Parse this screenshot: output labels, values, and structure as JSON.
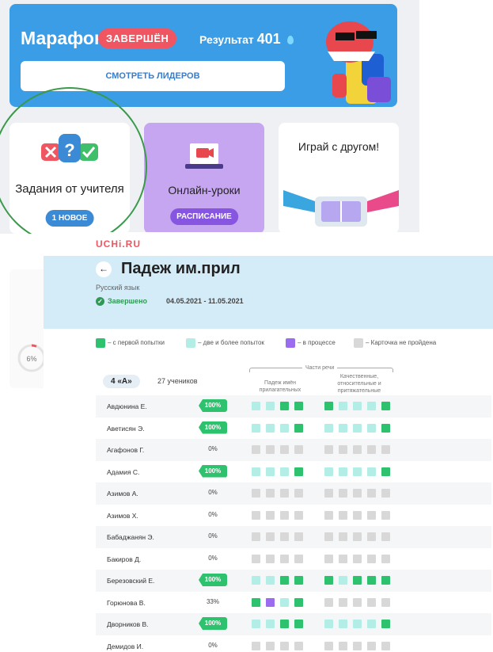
{
  "marathon": {
    "title": "Марафон",
    "status": "ЗАВЕРШЁН",
    "result_label": "Результат",
    "result_value": "401",
    "leaders_button": "СМОТРЕТЬ ЛИДЕРОВ"
  },
  "tiles": {
    "tasks": {
      "label": "Задания от учителя",
      "badge": "1 НОВОЕ"
    },
    "online": {
      "label": "Онлайн-уроки",
      "badge": "РАСПИСАНИЕ"
    },
    "game": {
      "label": "Играй с другом!"
    }
  },
  "side_progress": "6%",
  "report": {
    "logo": "UCHi.RU",
    "title": "Падеж им.прил",
    "subject": "Русский язык",
    "status": "Завершено",
    "dates": "04.05.2021 - 11.05.2021",
    "legend": [
      {
        "label": "– с первой попытки",
        "color": "#2ec26e"
      },
      {
        "label": "– две и более попыток",
        "color": "#b2eee6"
      },
      {
        "label": "– в процессе",
        "color": "#9b6cf0"
      },
      {
        "label": "– Карточка не пройдена",
        "color": "#d8d8d8"
      }
    ],
    "class_name": "4 «А»",
    "student_count": "27 учеников",
    "group_title": "Части речи",
    "subgroups": [
      "Падеж имён прилагательных",
      "Качественные, относительные и притяжательные прилагательные"
    ],
    "status_colors": {
      "g": "#2ec26e",
      "t": "#b2eee6",
      "p": "#9b6cf0",
      "x": "#d8d8d8"
    },
    "students": [
      {
        "name": "Авдюнина Е.",
        "percent": "100%",
        "cells": [
          "t",
          "t",
          "g",
          "g",
          "g",
          "t",
          "t",
          "t",
          "g"
        ]
      },
      {
        "name": "Аветисян Э.",
        "percent": "100%",
        "cells": [
          "t",
          "t",
          "t",
          "g",
          "t",
          "t",
          "t",
          "t",
          "g"
        ]
      },
      {
        "name": "Агафонов Г.",
        "percent": "0%",
        "cells": [
          "x",
          "x",
          "x",
          "x",
          "x",
          "x",
          "x",
          "x",
          "x"
        ]
      },
      {
        "name": "Адамия С.",
        "percent": "100%",
        "cells": [
          "t",
          "t",
          "t",
          "g",
          "t",
          "t",
          "t",
          "t",
          "g"
        ]
      },
      {
        "name": "Азимов А.",
        "percent": "0%",
        "cells": [
          "x",
          "x",
          "x",
          "x",
          "x",
          "x",
          "x",
          "x",
          "x"
        ]
      },
      {
        "name": "Азимов Х.",
        "percent": "0%",
        "cells": [
          "x",
          "x",
          "x",
          "x",
          "x",
          "x",
          "x",
          "x",
          "x"
        ]
      },
      {
        "name": "Бабаджанян Э.",
        "percent": "0%",
        "cells": [
          "x",
          "x",
          "x",
          "x",
          "x",
          "x",
          "x",
          "x",
          "x"
        ]
      },
      {
        "name": "Бакиров Д.",
        "percent": "0%",
        "cells": [
          "x",
          "x",
          "x",
          "x",
          "x",
          "x",
          "x",
          "x",
          "x"
        ]
      },
      {
        "name": "Березовский Е.",
        "percent": "100%",
        "cells": [
          "t",
          "t",
          "g",
          "g",
          "g",
          "t",
          "g",
          "g",
          "g"
        ]
      },
      {
        "name": "Горюнова В.",
        "percent": "33%",
        "cells": [
          "g",
          "p",
          "t",
          "g",
          "x",
          "x",
          "x",
          "x",
          "x"
        ]
      },
      {
        "name": "Дворников В.",
        "percent": "100%",
        "cells": [
          "t",
          "t",
          "g",
          "g",
          "t",
          "t",
          "t",
          "t",
          "g"
        ]
      },
      {
        "name": "Демидов И.",
        "percent": "0%",
        "cells": [
          "x",
          "x",
          "x",
          "x",
          "x",
          "x",
          "x",
          "x",
          "x"
        ]
      }
    ]
  }
}
